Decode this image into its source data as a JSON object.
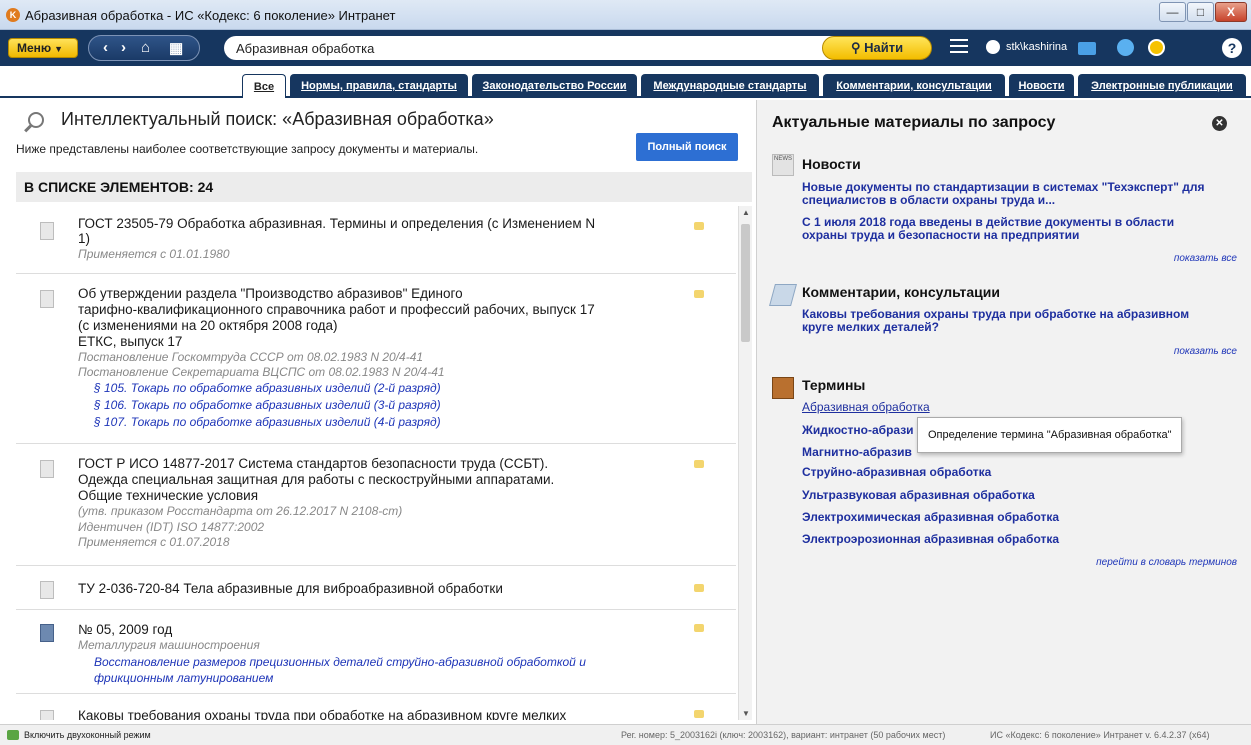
{
  "window": {
    "title": "Абразивная обработка - ИС «Кодекс: 6 поколение» Интранет",
    "min_glyph": "—",
    "max_glyph": "□",
    "close_glyph": "X"
  },
  "toolbar": {
    "menu_label": "Меню",
    "search_value": "Абразивная обработка",
    "search_button": "Найти",
    "username": "stk\\kashirina",
    "help_glyph": "?"
  },
  "tabs": [
    {
      "label": "Все",
      "active": true
    },
    {
      "label": "Нормы, правила, стандарты"
    },
    {
      "label": "Законодательство России"
    },
    {
      "label": "Международные стандарты"
    },
    {
      "label": "Комментарии, консультации"
    },
    {
      "label": "Новости"
    },
    {
      "label": "Электронные публикации"
    }
  ],
  "search": {
    "title": "Интеллектуальный поиск: «Абразивная обработка»",
    "subtitle": "Ниже представлены наиболее соответствующие запросу документы и материалы.",
    "full_search_button": "Полный поиск",
    "count_label": "В СПИСКЕ ЭЛЕМЕНТОВ: 24"
  },
  "results": [
    {
      "title": "ГОСТ 23505-79 Обработка абразивная. Термины и определения (с Изменением N 1)",
      "title_lines": [
        "ГОСТ 23505-79 Обработка абразивная. Термины и определения (с Изменением N",
        "1)"
      ],
      "meta": [
        "Применяется с 01.01.1980"
      ]
    },
    {
      "title_lines": [
        "Об утверждении раздела \"Производство абразивов\" Единого",
        "тарифно-квалификационного справочника работ и профессий рабочих, выпуск 17",
        "(с изменениями на 20 октября 2008 года)",
        "ЕТКС, выпуск 17"
      ],
      "meta": [
        "Постановление Госкомтруда СССР от 08.02.1983 N 20/4-41",
        "Постановление Секретариата ВЦСПС от 08.02.1983 N 20/4-41"
      ],
      "links": [
        "§ 105. Токарь по обработке абразивных изделий (2-й разряд)",
        "§ 106. Токарь по обработке абразивных изделий (3-й разряд)",
        "§ 107. Токарь по обработке абразивных изделий (4-й разряд)"
      ]
    },
    {
      "title_lines": [
        "ГОСТ Р ИСО 14877-2017 Система стандартов безопасности труда (ССБТ).",
        "Одежда специальная защитная для работы с пескоструйными аппаратами.",
        "Общие технические условия"
      ],
      "meta": [
        "(утв. приказом Росстандарта от 26.12.2017 N 2108-ст)",
        "Идентичен (IDT) ISO 14877:2002",
        "Применяется с 01.07.2018"
      ]
    },
    {
      "title_lines": [
        "ТУ 2-036-720-84 Тела абразивные для виброабразивной обработки"
      ]
    },
    {
      "title_lines": [
        "№ 05, 2009 год"
      ],
      "meta": [
        "Металлургия машиностроения"
      ],
      "links": [
        "Восстановление размеров прецизионных деталей струйно-абразивной обработкой и",
        "фрикционным латунированием"
      ]
    },
    {
      "title_lines": [
        "Каковы требования охраны труда при обработке на абразивном круге мелких"
      ]
    }
  ],
  "right": {
    "title": "Актуальные материалы по запросу",
    "news": {
      "icon_text": "NEWS",
      "title": "Новости",
      "items": [
        [
          "Новые документы по стандартизации в системах \"Техэксперт\" для",
          "специалистов в области охраны труда и..."
        ],
        [
          "С 1 июля 2018 года введены в действие документы в области",
          "охраны труда и безопасности на предприятии"
        ]
      ],
      "more": "показать все"
    },
    "comments": {
      "title": "Комментарии, консультации",
      "items": [
        [
          "Каковы требования охраны труда при обработке на абразивном",
          "круге мелких деталей?"
        ]
      ],
      "more": "показать все"
    },
    "terms": {
      "title": "Термины",
      "items": [
        "Абразивная обработка",
        "Жидкостно-абрази",
        "Магнитно-абразив",
        "Струйно-абразивная обработка",
        "Ультразвуковая абразивная обработка",
        "Электрохимическая абразивная обработка",
        "Электроэрозионная абразивная обработка"
      ],
      "more": "перейти в словарь терминов"
    },
    "tooltip": "Определение термина \"Абразивная обработка\""
  },
  "statusbar": {
    "dual_mode": "Включить двухоконный режим",
    "reg": "Рег. номер: 5_2003162i (ключ: 2003162), вариант: интранет (50 рабочих мест)",
    "version": "ИС «Кодекс: 6 поколение» Интранет v. 6.4.2.37 (x64)"
  }
}
